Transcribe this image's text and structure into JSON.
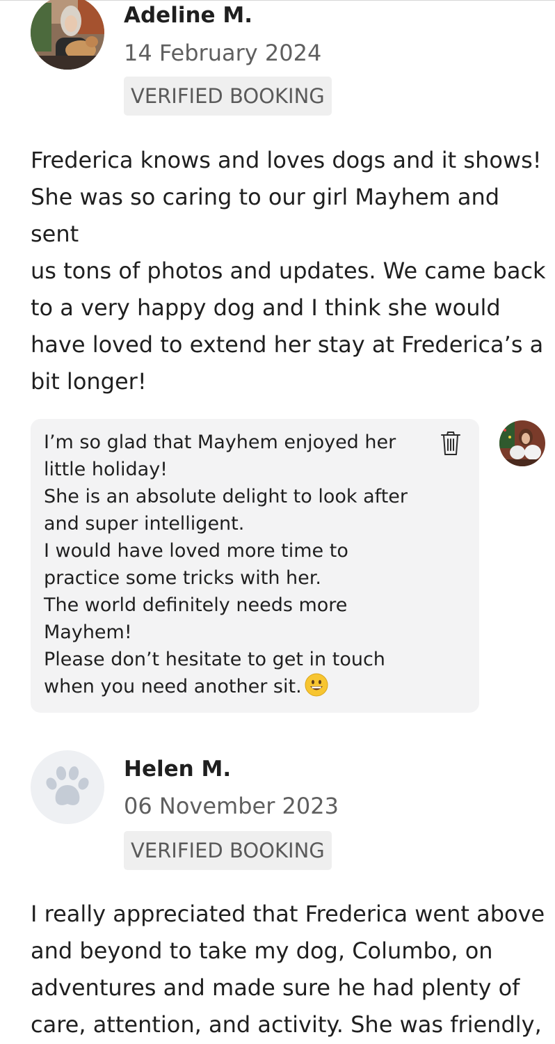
{
  "reviews": [
    {
      "name": "Adeline M.",
      "date": "14 February 2024",
      "badge": "VERIFIED BOOKING",
      "avatar_icon": "photo-avatar",
      "text": "Frederica knows and loves dogs and it shows!\nShe was so caring to our girl Mayhem and sent\nus tons of photos and updates. We came back\nto a very happy dog and I think she would\nhave loved to extend her stay at Frederica’s a\nbit longer!",
      "reply": {
        "text": "I’m so glad that Mayhem enjoyed her\nlittle holiday!\nShe is an absolute delight to look after\nand super intelligent.\nI would have loved more time to\npractice some tricks with her.\nThe world definitely needs more\nMayhem!\nPlease don’t hesitate to get in touch\nwhen you need another sit.",
        "emoji": "grinning-face-emoji",
        "delete_icon": "trash-icon"
      }
    },
    {
      "name": "Helen M.",
      "date": "06 November 2023",
      "badge": "VERIFIED BOOKING",
      "avatar_icon": "paw-icon",
      "text": "I really appreciated that Frederica went above\nand beyond to take my dog, Columbo, on\nadventures and made sure he had plenty of\ncare, attention, and activity. She was friendly,"
    }
  ],
  "colors": {
    "text": "#1f1f1f",
    "muted": "#5f5f5f",
    "badge_bg": "#efefef",
    "reply_bg": "#f3f3f4",
    "paw": "#c5ccd6",
    "paw_bg": "#eef0f3"
  }
}
